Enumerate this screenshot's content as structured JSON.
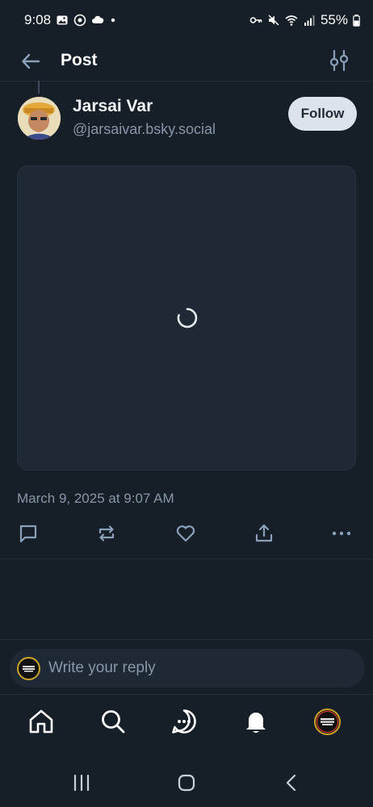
{
  "status_bar": {
    "time": "9:08",
    "battery": "55%"
  },
  "header": {
    "title": "Post"
  },
  "post": {
    "author_name": "Jarsai Var",
    "author_handle": "@jarsaivar.bsky.social",
    "follow_label": "Follow",
    "timestamp": "March 9, 2025 at 9:07 AM"
  },
  "reply": {
    "placeholder": "Write your reply"
  },
  "icons": {
    "back": "arrow-left-icon",
    "filter": "sliders-icon",
    "reply": "chat-bubble-icon",
    "repost": "repost-icon",
    "like": "heart-icon",
    "share": "share-icon",
    "more": "more-dots-icon",
    "home": "home-icon",
    "search": "search-icon",
    "chat": "chat-icon",
    "notifications": "bell-icon"
  },
  "colors": {
    "background": "#161e27",
    "media_background": "#1e2935",
    "muted_text": "#8796a8",
    "icon_color": "#8aa0b8",
    "follow_button_bg": "#dde3ea"
  }
}
